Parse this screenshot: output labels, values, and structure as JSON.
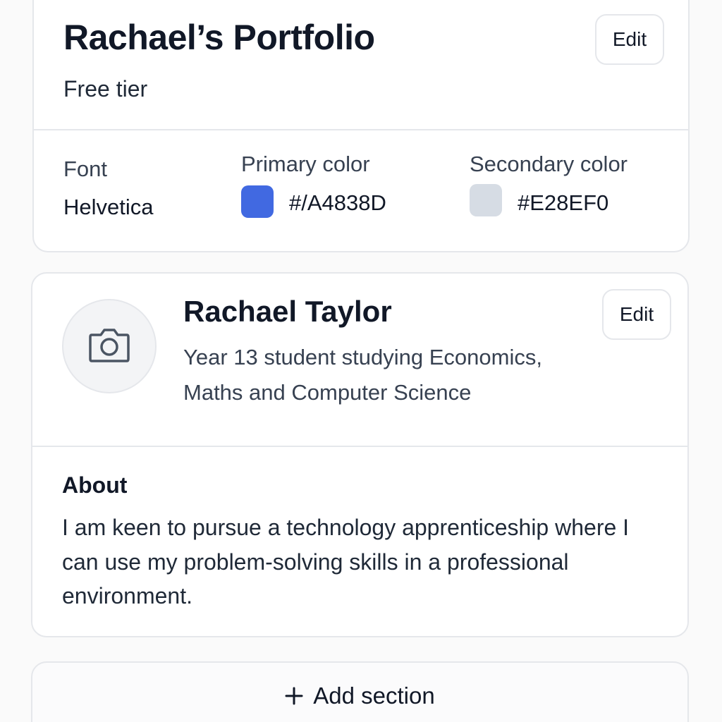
{
  "portfolio": {
    "title": "Rachael’s Portfolio",
    "tier": "Free tier",
    "edit_label": "Edit",
    "font": {
      "label": "Font",
      "value": "Helvetica"
    },
    "primary_color": {
      "label": "Primary color",
      "value": "#/A4838D",
      "swatch": "#4169E1"
    },
    "secondary_color": {
      "label": "Secondary color",
      "value": "#E28EF0",
      "swatch": "#D6DCE4"
    }
  },
  "profile": {
    "name": "Rachael Taylor",
    "bio": "Year 13 student studying Economics, Maths and Computer Science",
    "edit_label": "Edit",
    "avatar_icon": "camera-icon",
    "about": {
      "heading": "About",
      "text": "I am keen to pursue a technology apprenticeship where I can use my problem-solving skills in a professional environment."
    }
  },
  "add_section": {
    "label": "Add section",
    "icon": "plus-icon"
  }
}
